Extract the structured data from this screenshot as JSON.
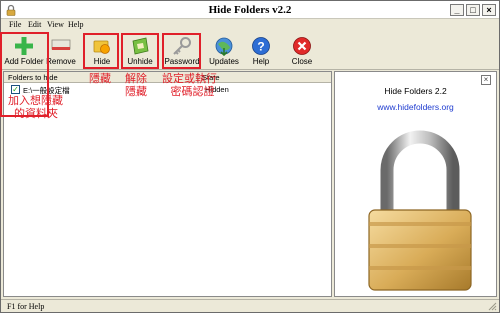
{
  "window": {
    "title": "Hide Folders v2.2"
  },
  "title_buttons": {
    "minimize": "_",
    "maximize": "□",
    "close": "×"
  },
  "menu": [
    "File",
    "Edit",
    "View",
    "Help"
  ],
  "toolbar": {
    "add_folder": "Add Folder",
    "remove": "Remove",
    "hide": "Hide",
    "unhide": "Unhide",
    "password": "Password",
    "updates": "Updates",
    "help": "Help",
    "close": "Close"
  },
  "list": {
    "headers": {
      "folder": "Folders to hide",
      "status": "State"
    },
    "rows": [
      {
        "checked": true,
        "check_mark": "✓",
        "path": "E:\\一般設定檔",
        "status": "Hidden"
      }
    ]
  },
  "info_panel": {
    "close_glyph": "×",
    "title": "Hide Folders 2.2",
    "url": "www.hidefolders.org"
  },
  "statusbar": {
    "text": "F1 for Help"
  },
  "annotations": {
    "add_folder_line1": "加入想隱藏",
    "add_folder_line2": "的資料夾",
    "hide": "隱藏",
    "unhide_line1": "解除",
    "unhide_line2": "隱藏",
    "password_line1": "設定或執行",
    "password_line2": "密碼認證"
  },
  "colors": {
    "annotation": "#e0202a",
    "link": "#1f3cd0",
    "chrome": "#ece9d8"
  }
}
